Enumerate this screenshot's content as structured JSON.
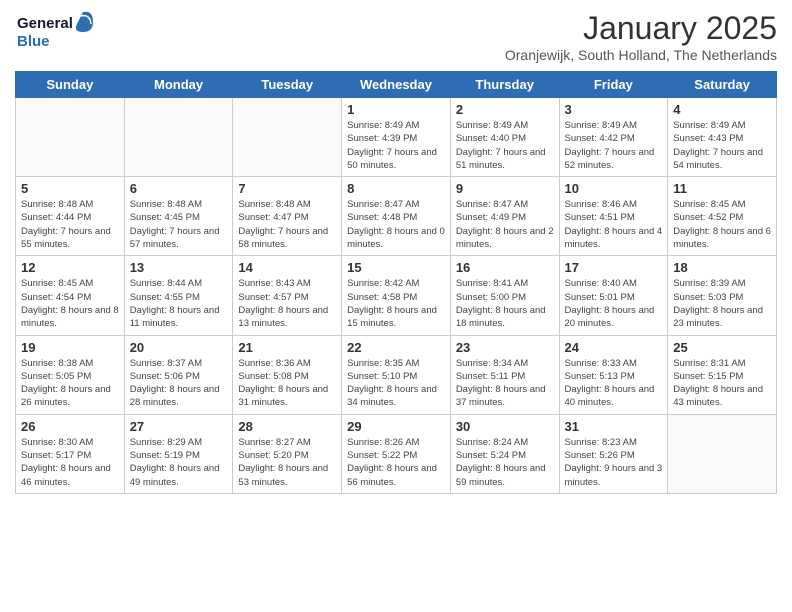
{
  "header": {
    "logo_general": "General",
    "logo_blue": "Blue",
    "title": "January 2025",
    "location": "Oranjewijk, South Holland, The Netherlands"
  },
  "weekdays": [
    "Sunday",
    "Monday",
    "Tuesday",
    "Wednesday",
    "Thursday",
    "Friday",
    "Saturday"
  ],
  "weeks": [
    [
      {
        "day": "",
        "info": ""
      },
      {
        "day": "",
        "info": ""
      },
      {
        "day": "",
        "info": ""
      },
      {
        "day": "1",
        "info": "Sunrise: 8:49 AM\nSunset: 4:39 PM\nDaylight: 7 hours\nand 50 minutes."
      },
      {
        "day": "2",
        "info": "Sunrise: 8:49 AM\nSunset: 4:40 PM\nDaylight: 7 hours\nand 51 minutes."
      },
      {
        "day": "3",
        "info": "Sunrise: 8:49 AM\nSunset: 4:42 PM\nDaylight: 7 hours\nand 52 minutes."
      },
      {
        "day": "4",
        "info": "Sunrise: 8:49 AM\nSunset: 4:43 PM\nDaylight: 7 hours\nand 54 minutes."
      }
    ],
    [
      {
        "day": "5",
        "info": "Sunrise: 8:48 AM\nSunset: 4:44 PM\nDaylight: 7 hours\nand 55 minutes."
      },
      {
        "day": "6",
        "info": "Sunrise: 8:48 AM\nSunset: 4:45 PM\nDaylight: 7 hours\nand 57 minutes."
      },
      {
        "day": "7",
        "info": "Sunrise: 8:48 AM\nSunset: 4:47 PM\nDaylight: 7 hours\nand 58 minutes."
      },
      {
        "day": "8",
        "info": "Sunrise: 8:47 AM\nSunset: 4:48 PM\nDaylight: 8 hours\nand 0 minutes."
      },
      {
        "day": "9",
        "info": "Sunrise: 8:47 AM\nSunset: 4:49 PM\nDaylight: 8 hours\nand 2 minutes."
      },
      {
        "day": "10",
        "info": "Sunrise: 8:46 AM\nSunset: 4:51 PM\nDaylight: 8 hours\nand 4 minutes."
      },
      {
        "day": "11",
        "info": "Sunrise: 8:45 AM\nSunset: 4:52 PM\nDaylight: 8 hours\nand 6 minutes."
      }
    ],
    [
      {
        "day": "12",
        "info": "Sunrise: 8:45 AM\nSunset: 4:54 PM\nDaylight: 8 hours\nand 8 minutes."
      },
      {
        "day": "13",
        "info": "Sunrise: 8:44 AM\nSunset: 4:55 PM\nDaylight: 8 hours\nand 11 minutes."
      },
      {
        "day": "14",
        "info": "Sunrise: 8:43 AM\nSunset: 4:57 PM\nDaylight: 8 hours\nand 13 minutes."
      },
      {
        "day": "15",
        "info": "Sunrise: 8:42 AM\nSunset: 4:58 PM\nDaylight: 8 hours\nand 15 minutes."
      },
      {
        "day": "16",
        "info": "Sunrise: 8:41 AM\nSunset: 5:00 PM\nDaylight: 8 hours\nand 18 minutes."
      },
      {
        "day": "17",
        "info": "Sunrise: 8:40 AM\nSunset: 5:01 PM\nDaylight: 8 hours\nand 20 minutes."
      },
      {
        "day": "18",
        "info": "Sunrise: 8:39 AM\nSunset: 5:03 PM\nDaylight: 8 hours\nand 23 minutes."
      }
    ],
    [
      {
        "day": "19",
        "info": "Sunrise: 8:38 AM\nSunset: 5:05 PM\nDaylight: 8 hours\nand 26 minutes."
      },
      {
        "day": "20",
        "info": "Sunrise: 8:37 AM\nSunset: 5:06 PM\nDaylight: 8 hours\nand 28 minutes."
      },
      {
        "day": "21",
        "info": "Sunrise: 8:36 AM\nSunset: 5:08 PM\nDaylight: 8 hours\nand 31 minutes."
      },
      {
        "day": "22",
        "info": "Sunrise: 8:35 AM\nSunset: 5:10 PM\nDaylight: 8 hours\nand 34 minutes."
      },
      {
        "day": "23",
        "info": "Sunrise: 8:34 AM\nSunset: 5:11 PM\nDaylight: 8 hours\nand 37 minutes."
      },
      {
        "day": "24",
        "info": "Sunrise: 8:33 AM\nSunset: 5:13 PM\nDaylight: 8 hours\nand 40 minutes."
      },
      {
        "day": "25",
        "info": "Sunrise: 8:31 AM\nSunset: 5:15 PM\nDaylight: 8 hours\nand 43 minutes."
      }
    ],
    [
      {
        "day": "26",
        "info": "Sunrise: 8:30 AM\nSunset: 5:17 PM\nDaylight: 8 hours\nand 46 minutes."
      },
      {
        "day": "27",
        "info": "Sunrise: 8:29 AM\nSunset: 5:19 PM\nDaylight: 8 hours\nand 49 minutes."
      },
      {
        "day": "28",
        "info": "Sunrise: 8:27 AM\nSunset: 5:20 PM\nDaylight: 8 hours\nand 53 minutes."
      },
      {
        "day": "29",
        "info": "Sunrise: 8:26 AM\nSunset: 5:22 PM\nDaylight: 8 hours\nand 56 minutes."
      },
      {
        "day": "30",
        "info": "Sunrise: 8:24 AM\nSunset: 5:24 PM\nDaylight: 8 hours\nand 59 minutes."
      },
      {
        "day": "31",
        "info": "Sunrise: 8:23 AM\nSunset: 5:26 PM\nDaylight: 9 hours\nand 3 minutes."
      },
      {
        "day": "",
        "info": ""
      }
    ]
  ]
}
